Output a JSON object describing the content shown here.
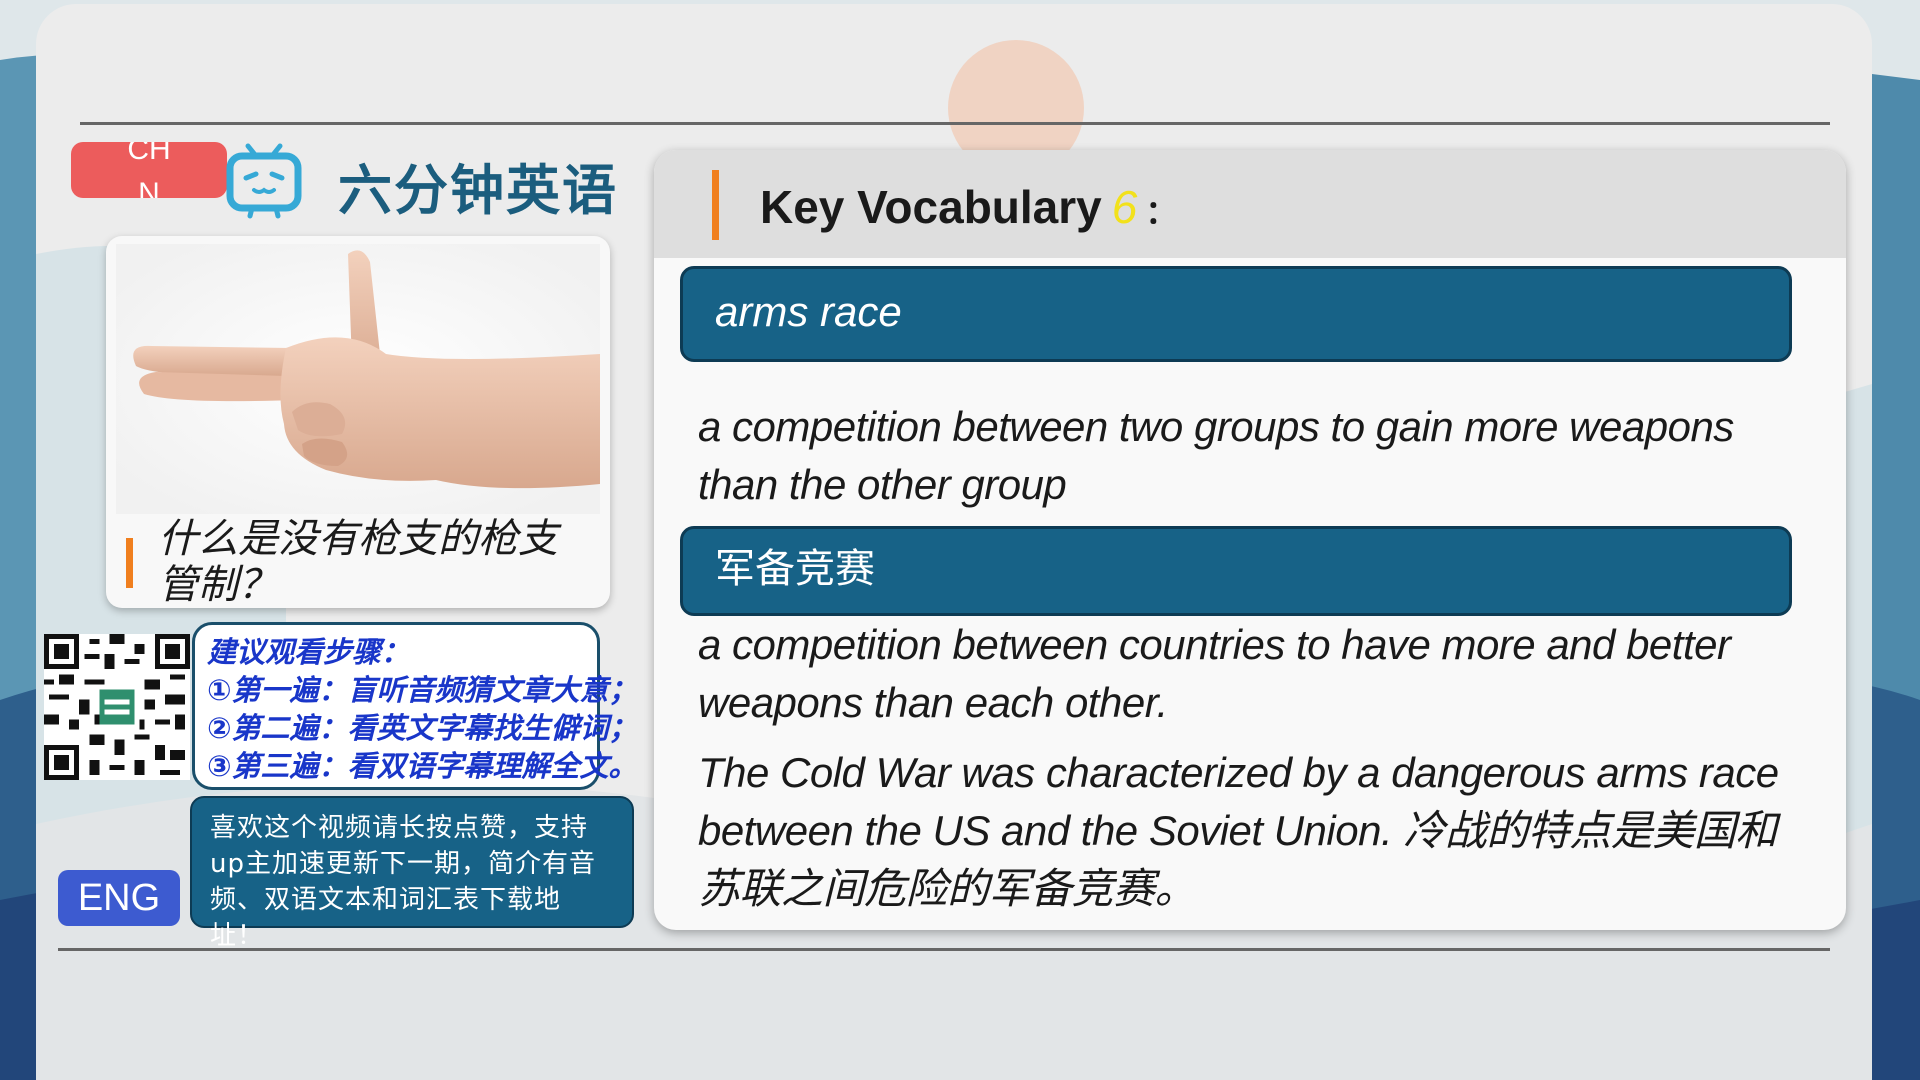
{
  "header": {
    "chn_label": "CHN",
    "brand_title": "六分钟英语"
  },
  "photo_card": {
    "question": "什么是没有枪支的枪支管制？"
  },
  "steps": {
    "lines": [
      "建议观看步骤：",
      "①第一遍：盲听音频猜文章大意；",
      "②第二遍：看英文字幕找生僻词；",
      "③第三遍：看双语字幕理解全文。"
    ]
  },
  "support": {
    "text": "喜欢这个视频请长按点赞，支持up主加速更新下一期，简介有音频、双语文本和词汇表下载地址！"
  },
  "eng_label": "ENG",
  "vocab": {
    "title": "Key Vocabulary",
    "number": "6",
    "colon": "：",
    "term_en": "arms race",
    "definition_en": "a competition between two groups to gain more weapons than the other group",
    "term_zh": "军备竞赛",
    "definition_alt": "a competition between countries to have more and better weapons than each other.",
    "example": "The Cold War was characterized by a dangerous arms race between the US and the Soviet Union. 冷战的特点是美国和苏联之间危险的军备竞赛。"
  },
  "colors": {
    "accent_orange": "#f07f1e",
    "pill_blue": "#176287",
    "chn_red": "#ec5c5c",
    "eng_blue": "#3d5bd0",
    "steps_blue": "#1936c9",
    "number_yellow": "#f2e11b"
  },
  "icons": [
    "bilibili-tv-icon",
    "hand-gun-gesture-image",
    "qr-code"
  ]
}
